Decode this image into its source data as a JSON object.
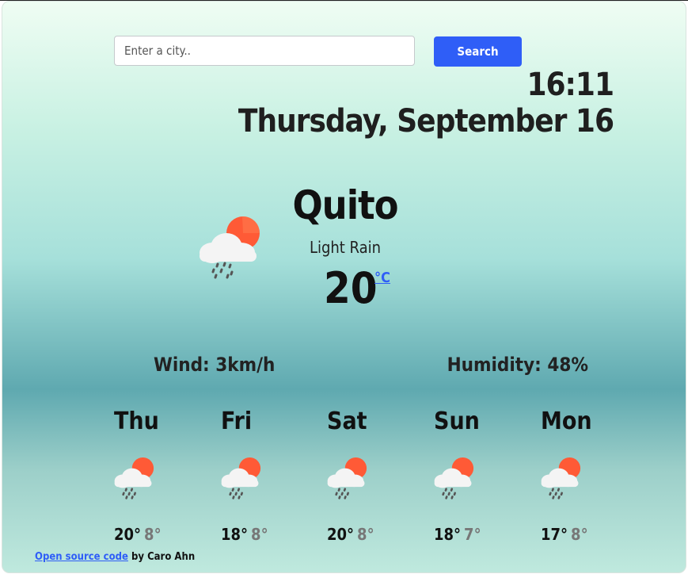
{
  "search": {
    "placeholder": "Enter a city..",
    "value": "",
    "button_label": "Search"
  },
  "clock": {
    "time": "16:11",
    "date": "Thursday, September 16"
  },
  "current": {
    "city": "Quito",
    "condition": "Light Rain",
    "temperature": "20",
    "unit": "°C",
    "icon": "rain-cloud-sun-icon"
  },
  "details": {
    "wind": "Wind: 3km/h",
    "humidity": "Humidity: 48%"
  },
  "forecast": [
    {
      "day": "Thu",
      "high": "20°",
      "low": "8°",
      "icon": "rain-cloud-sun-icon"
    },
    {
      "day": "Fri",
      "high": "18°",
      "low": "8°",
      "icon": "rain-cloud-sun-icon"
    },
    {
      "day": "Sat",
      "high": "20°",
      "low": "8°",
      "icon": "rain-cloud-sun-icon"
    },
    {
      "day": "Sun",
      "high": "18°",
      "low": "7°",
      "icon": "rain-cloud-sun-icon"
    },
    {
      "day": "Mon",
      "high": "17°",
      "low": "8°",
      "icon": "rain-cloud-sun-icon"
    }
  ],
  "footer": {
    "link_text": "Open source code",
    "by_text": " by Caro Ahn"
  },
  "colors": {
    "accent": "#2f5ef7",
    "sun": "#ff5a36",
    "cloud": "#f2f2f2"
  }
}
